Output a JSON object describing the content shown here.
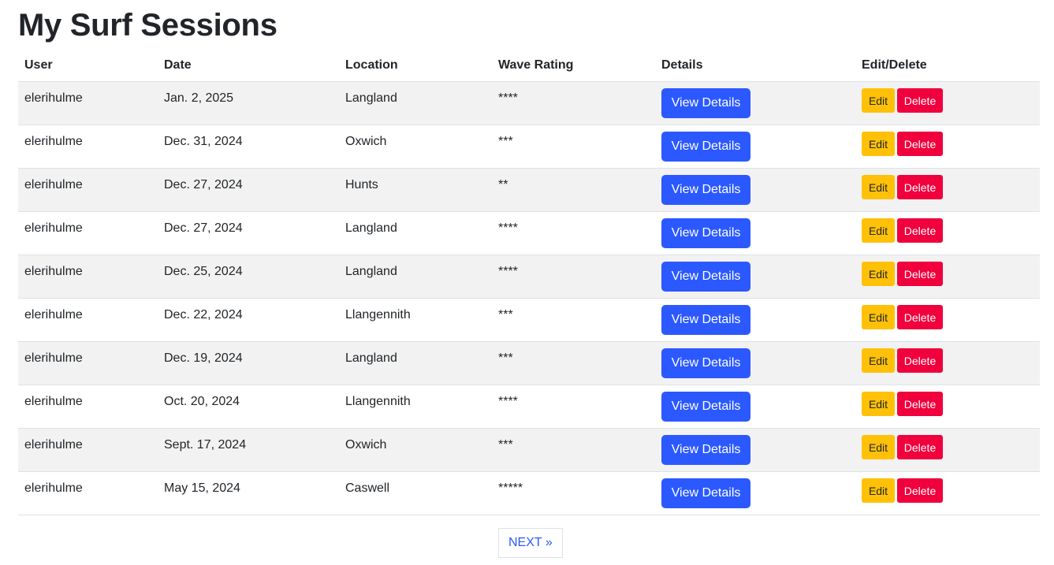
{
  "page": {
    "title": "My Surf Sessions"
  },
  "table": {
    "columns": [
      "User",
      "Date",
      "Location",
      "Wave Rating",
      "Details",
      "Edit/Delete"
    ],
    "rows": [
      {
        "user": "elerihulme",
        "date": "Jan. 2, 2025",
        "location": "Langland",
        "rating": "****"
      },
      {
        "user": "elerihulme",
        "date": "Dec. 31, 2024",
        "location": "Oxwich",
        "rating": "***"
      },
      {
        "user": "elerihulme",
        "date": "Dec. 27, 2024",
        "location": "Hunts",
        "rating": "**"
      },
      {
        "user": "elerihulme",
        "date": "Dec. 27, 2024",
        "location": "Langland",
        "rating": "****"
      },
      {
        "user": "elerihulme",
        "date": "Dec. 25, 2024",
        "location": "Langland",
        "rating": "****"
      },
      {
        "user": "elerihulme",
        "date": "Dec. 22, 2024",
        "location": "Llangennith",
        "rating": "***"
      },
      {
        "user": "elerihulme",
        "date": "Dec. 19, 2024",
        "location": "Langland",
        "rating": "***"
      },
      {
        "user": "elerihulme",
        "date": "Oct. 20, 2024",
        "location": "Llangennith",
        "rating": "****"
      },
      {
        "user": "elerihulme",
        "date": "Sept. 17, 2024",
        "location": "Oxwich",
        "rating": "***"
      },
      {
        "user": "elerihulme",
        "date": "May 15, 2024",
        "location": "Caswell",
        "rating": "*****"
      }
    ]
  },
  "buttons": {
    "view_details": "View Details",
    "edit": "Edit",
    "delete": "Delete"
  },
  "pagination": {
    "next_label": "NEXT »"
  },
  "colors": {
    "primary": "#2b59ff",
    "warning": "#ffc107",
    "danger": "#f0003c",
    "stripe": "#f2f2f2"
  }
}
